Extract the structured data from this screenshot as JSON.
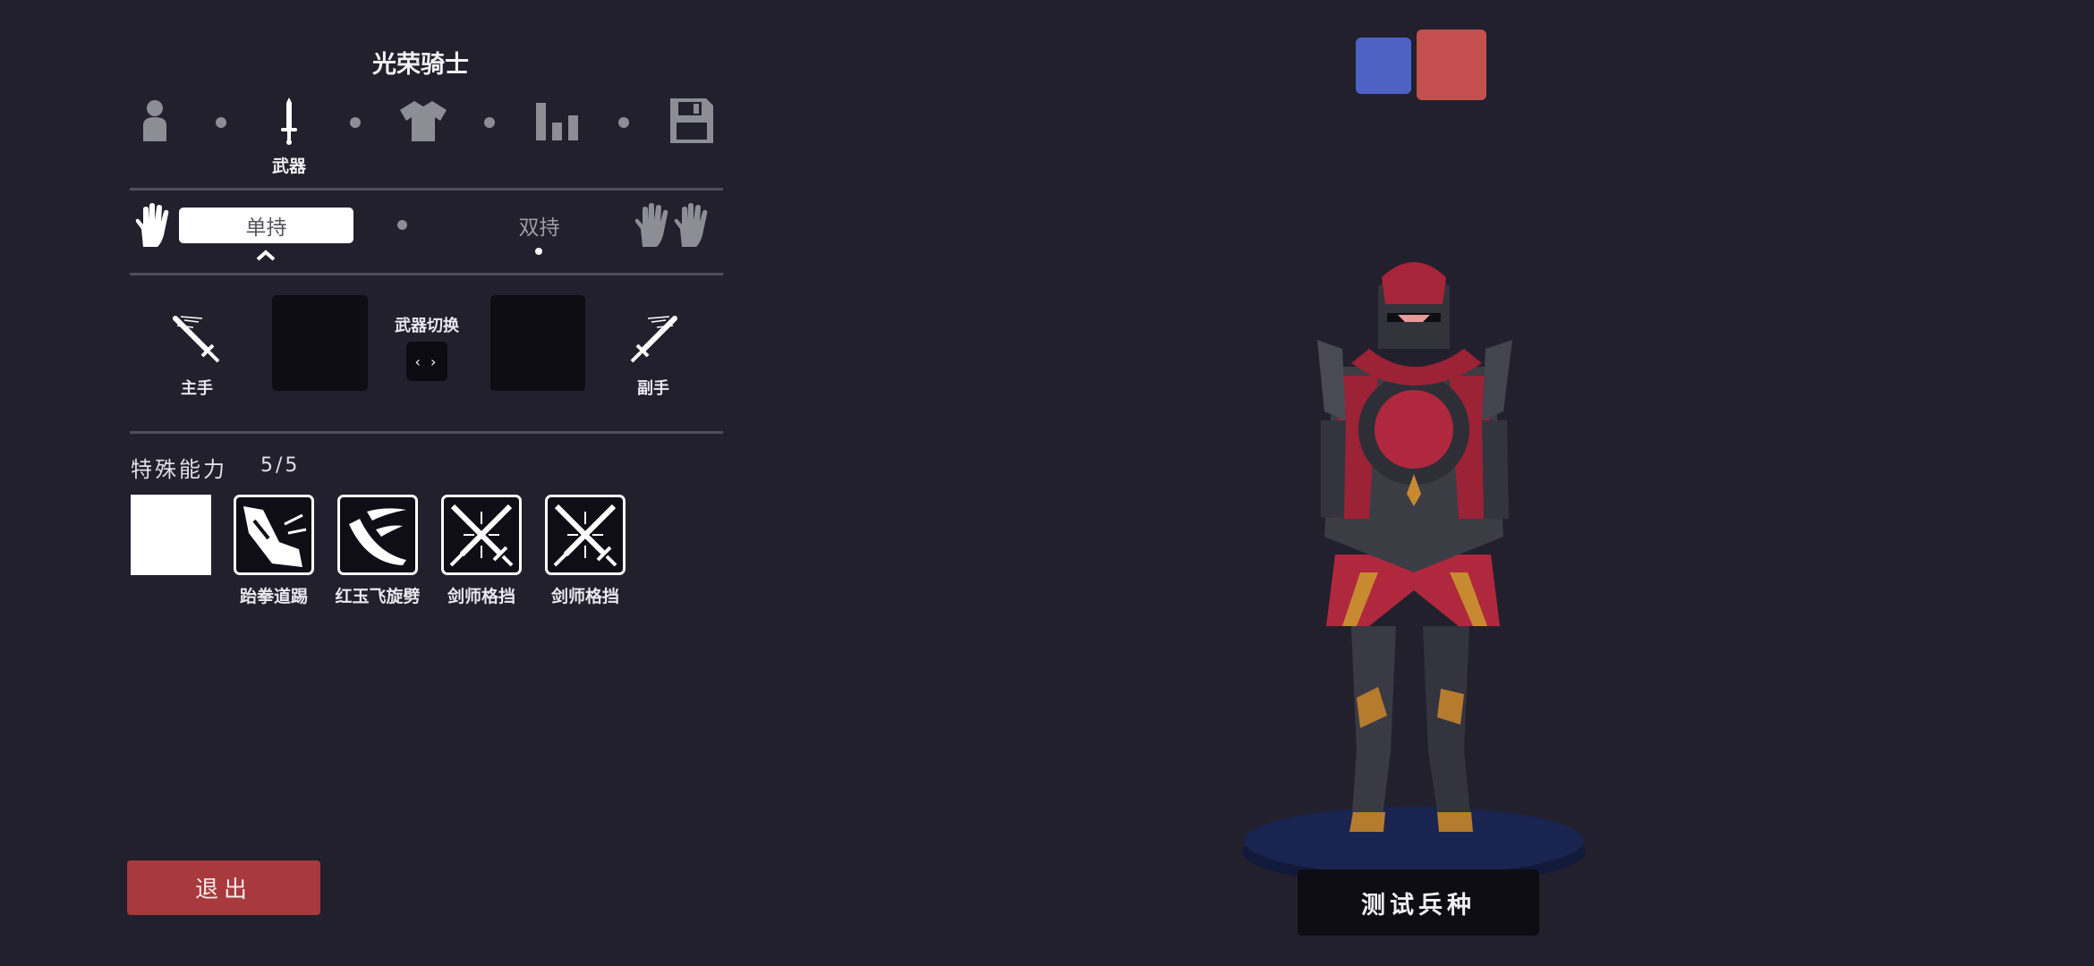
{
  "unit_name": "光荣骑士",
  "tabs": [
    {
      "icon": "person-icon",
      "label": ""
    },
    {
      "icon": "sword-icon",
      "label": "武器",
      "active": true
    },
    {
      "icon": "shirt-icon",
      "label": ""
    },
    {
      "icon": "stats-icon",
      "label": ""
    },
    {
      "icon": "save-icon",
      "label": ""
    }
  ],
  "grip": {
    "single_label": "单持",
    "dual_label": "双持",
    "selected": "single"
  },
  "weapons": {
    "main_hand_label": "主手",
    "off_hand_label": "副手",
    "switch_label": "武器切换",
    "switch_button": "‹ ›"
  },
  "abilities": {
    "title": "特殊能力",
    "count": "5/5",
    "items": [
      {
        "label": "",
        "icon": "empty-slot"
      },
      {
        "label": "跆拳道踢",
        "icon": "kick-icon"
      },
      {
        "label": "红玉飞旋劈",
        "icon": "spin-slash-icon"
      },
      {
        "label": "剑师格挡",
        "icon": "crossed-swords-icon"
      },
      {
        "label": "剑师格挡",
        "icon": "crossed-swords-icon"
      }
    ]
  },
  "exit_label": "退出",
  "test_label": "测试兵种",
  "colors": {
    "background": "#22202c",
    "team_blue": "#4e62c4",
    "team_red": "#c3504f",
    "exit_button": "#a8393c",
    "knight_crimson": "#b0283e",
    "knight_armor": "#3c3c45"
  }
}
